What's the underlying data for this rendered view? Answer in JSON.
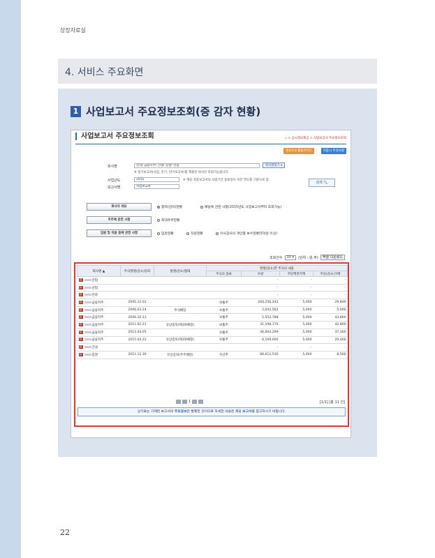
{
  "running_head": "상장자료실",
  "section_title": "4. 서비스 주요화면",
  "subsection": {
    "number": "1",
    "title": "사업보고서 주요정보조회(증 감자 현황)"
  },
  "screen": {
    "title": "사업보고서 주요정보조회",
    "breadcrumb": {
      "home": "⌂",
      "path": "> 공시정보제공 > 사업보고서 주요정보조회"
    },
    "buttons": {
      "guide": "정보3.0 활용가이드",
      "help": "이용시 주의사항"
    },
    "form": {
      "company_label": "회사명",
      "company_value": "전자/       금융지주/      건설/      증권/      산업",
      "company_button": "회사명찾기 ▾",
      "company_note": "※ 정기보고서(사업, 분기, 반기보고서)를 제출한 회사만 조회가능합니다.",
      "year_label": "사업년도",
      "year_value": "2015",
      "year_note": "※ 해당 최종보고서의 사업기간 종료일이 속한 연도를 기준으로 함.",
      "report_label": "보고서명",
      "report_value": "사업보고서",
      "search_button": "검색 🔍"
    },
    "categories": [
      {
        "label": "회사의 개요",
        "options": [
          {
            "text": "증자(감자)현황",
            "selected": true
          },
          {
            "text": "배당에 관한 사항(2015년도 사업보고서부터 조회가능)",
            "selected": false
          }
        ]
      },
      {
        "label": "주주에 관한 사항",
        "options": [
          {
            "text": "최대주주현황",
            "selected": false
          }
        ]
      },
      {
        "label": "임원 및 직원 등에 관한 사항",
        "options": [
          {
            "text": "임원현황",
            "selected": false
          },
          {
            "text": "직원현황",
            "selected": false
          },
          {
            "text": "이사감사의 개인별 보수현황(5억원 이상)",
            "selected": false
          }
        ]
      }
    ],
    "count_label": "조회건수",
    "count_value": "15 ▾",
    "unit": "(단위 : 원,주)",
    "excel_button": "엑셀 다운로드",
    "table": {
      "group_header": "발행(감소)한 주식의 내용",
      "headers": [
        "회사명 ▲",
        "주식발행(감소)일자",
        "발행(감소)형태",
        "주식의 종류",
        "수량",
        "주당액면가액",
        "주당(감소)가액"
      ],
      "rows": [
        {
          "company": "산업",
          "date": "",
          "type": "",
          "kind": "",
          "qty": "-",
          "par": "-",
          "price": "-"
        },
        {
          "company": "산업",
          "date": "",
          "type": "",
          "kind": "",
          "qty": "-",
          "par": "-",
          "price": "-"
        },
        {
          "company": "전자",
          "date": "",
          "type": "",
          "kind": "",
          "qty": "-",
          "par": "-",
          "price": "-"
        },
        {
          "company": "금융지주",
          "date": "2005.12.01",
          "type": "",
          "kind": "보통주",
          "qty": "204,256,243",
          "par": "5,000",
          "price": "29,849"
        },
        {
          "company": "금융지주",
          "date": "2006.03.24",
          "type": "주식배당",
          "kind": "보통주",
          "qty": "2,042,562",
          "par": "5,000",
          "price": "5,000"
        },
        {
          "company": "금융지주",
          "date": "2006.10.13",
          "type": "",
          "kind": "보통주",
          "qty": "5,552,788",
          "par": "5,000",
          "price": "43,800"
        },
        {
          "company": "금융지주",
          "date": "2011.02.21",
          "type": "유상증자(제3자배정)",
          "kind": "보통주",
          "qty": "31,198,170",
          "par": "5,000",
          "price": "42,800"
        },
        {
          "company": "금융지주",
          "date": "2013.04.05",
          "type": "",
          "kind": "보통주",
          "qty": "46,844,299",
          "par": "5,000",
          "price": "37,300"
        },
        {
          "company": "금융지주",
          "date": "2015.04.22",
          "type": "유상증자(제3자배정)",
          "kind": "보통주",
          "qty": "6,109,000",
          "par": "5,000",
          "price": "29,466"
        },
        {
          "company": "건설",
          "date": "",
          "type": "",
          "kind": "",
          "qty": "-",
          "par": "-",
          "price": "-"
        },
        {
          "company": "증권",
          "date": "2011.12.30",
          "type": "유상증자(주주배정)",
          "kind": "우선주",
          "qty": "66,612,530",
          "par": "5,000",
          "price": "8,500"
        }
      ],
      "tag": "유"
    },
    "pager": {
      "page": "1"
    },
    "total": "[1/1] [총 11 건]",
    "notice": {
      "pre": "상기표는 기재된 보고서의 ",
      "b1": "주요정보",
      "mid": "만 발췌한 것이므로 자세한 내용은 해당 ",
      "b2": "보고서",
      "post": "를 참고하시기 바랍니다."
    }
  },
  "page_number": "22"
}
